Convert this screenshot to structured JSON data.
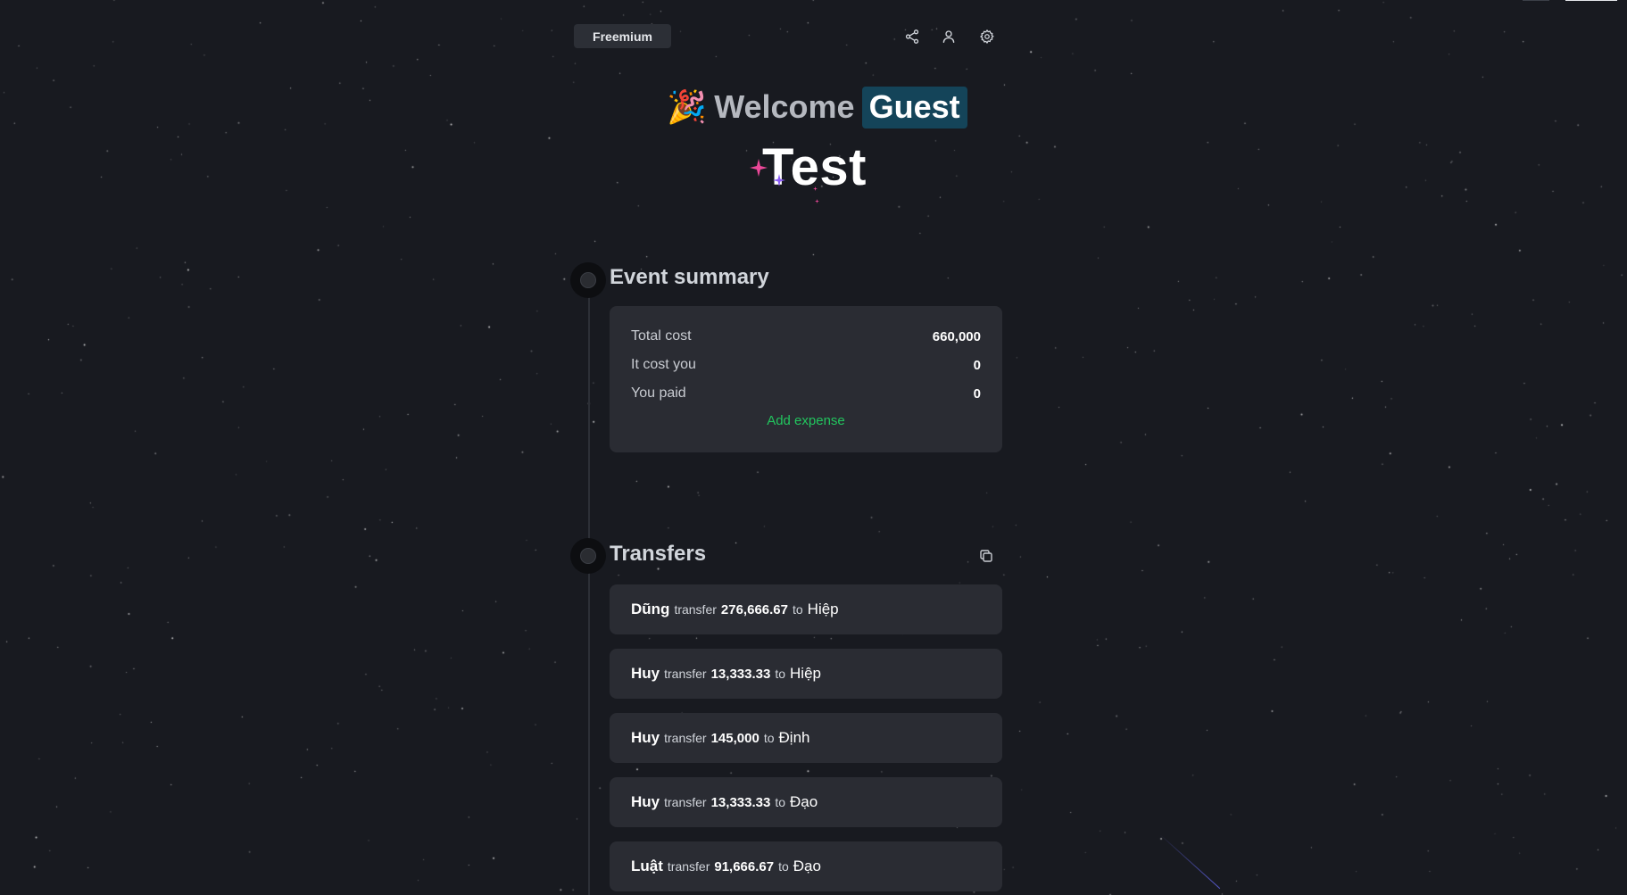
{
  "header": {
    "plan_label": "Freemium",
    "icons": [
      "share-icon",
      "user-icon",
      "settings-icon"
    ]
  },
  "welcome": {
    "emoji": "🎉",
    "text": "Welcome",
    "user_badge": "Guest"
  },
  "event": {
    "name": "Test"
  },
  "summary": {
    "title": "Event summary",
    "rows": [
      {
        "label": "Total cost",
        "value": "660,000"
      },
      {
        "label": "It cost you",
        "value": "0"
      },
      {
        "label": "You paid",
        "value": "0"
      }
    ],
    "add_expense_label": "Add expense"
  },
  "transfers": {
    "title": "Transfers",
    "copy_icon": "copy-icon",
    "items": [
      {
        "from": "Dũng",
        "verb": "transfer",
        "amount": "276,666.67",
        "to_word": "to",
        "to": "Hiệp"
      },
      {
        "from": "Huy",
        "verb": "transfer",
        "amount": "13,333.33",
        "to_word": "to",
        "to": "Hiệp"
      },
      {
        "from": "Huy",
        "verb": "transfer",
        "amount": "145,000",
        "to_word": "to",
        "to": "Định"
      },
      {
        "from": "Huy",
        "verb": "transfer",
        "amount": "13,333.33",
        "to_word": "to",
        "to": "Đạo"
      },
      {
        "from": "Luật",
        "verb": "transfer",
        "amount": "91,666.67",
        "to_word": "to",
        "to": "Đạo"
      }
    ]
  },
  "colors": {
    "background": "#181a20",
    "card": "#2a2c33",
    "accent_green": "#22c55e",
    "guest_badge": "#144459"
  }
}
